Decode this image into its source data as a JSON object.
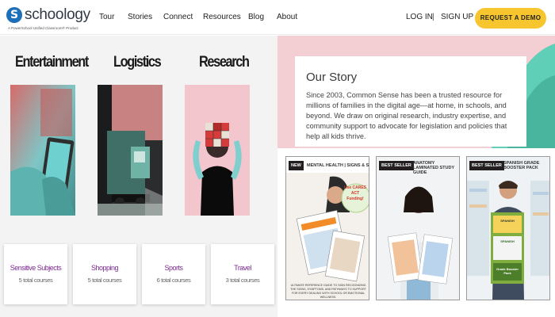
{
  "header": {
    "logo_text": "schoology",
    "logo_letter": "S",
    "logo_subtitle": "A PowerSchool Unified Classroom® Product",
    "nav": [
      "Tour",
      "Stories",
      "Connect",
      "Resources",
      "Blog",
      "About"
    ],
    "login": "LOG IN",
    "separator": "|",
    "signup": "SIGN UP",
    "cta": "REQUEST A DEMO"
  },
  "categories": [
    {
      "title": "Entertainment",
      "icon": "tablet-hands-image"
    },
    {
      "title": "Logistics",
      "icon": "truck-image"
    },
    {
      "title": "Research",
      "icon": "cube-puzzle-image"
    }
  ],
  "topics": [
    {
      "name": "Sensitive Subjects",
      "count": "5 total courses"
    },
    {
      "name": "Shopping",
      "count": "5 total courses"
    },
    {
      "name": "Sports",
      "count": "6 total courses"
    },
    {
      "name": "Travel",
      "count": "3 total courses"
    }
  ],
  "story": {
    "title": "Our Story",
    "text": "Since 2003, Common Sense has been a trusted resource for millions of families in the digital age—at home, in schools, and beyond. We draw on original research, industry expertise, and community support to advocate for legislation and policies that help all kids thrive."
  },
  "products": [
    {
      "badge": "NEW",
      "label": "MENTAL HEALTH | SIGNS & SUPPORT",
      "callout": "Use CARES ACT Funding!",
      "caption": "ULTIMATE REFERENCE GUIDE TO SIGN RECOGNIZING THE SIGNS, SYMPTOMS, AND PATHWAYS TO SUPPORT FOR EVERY DEALING WITH SCHOOL OR EMOTIONAL WELLNESS."
    },
    {
      "badge": "BEST SELLER",
      "label": "ANATOMY LAMINATED STUDY GUIDE"
    },
    {
      "badge": "BEST SELLER",
      "label": "SPANISH GRADE BOOSTER PACK",
      "cover_top": "SPANISH",
      "cover_mid": "SPANISH",
      "cover_bottom": "Grade Booster Pack"
    }
  ],
  "colors": {
    "accent_yellow": "#f7c62f",
    "logo_blue": "#1d6fb8",
    "topic_purple": "#7b2a8f",
    "story_pink": "#f3cfd3"
  }
}
